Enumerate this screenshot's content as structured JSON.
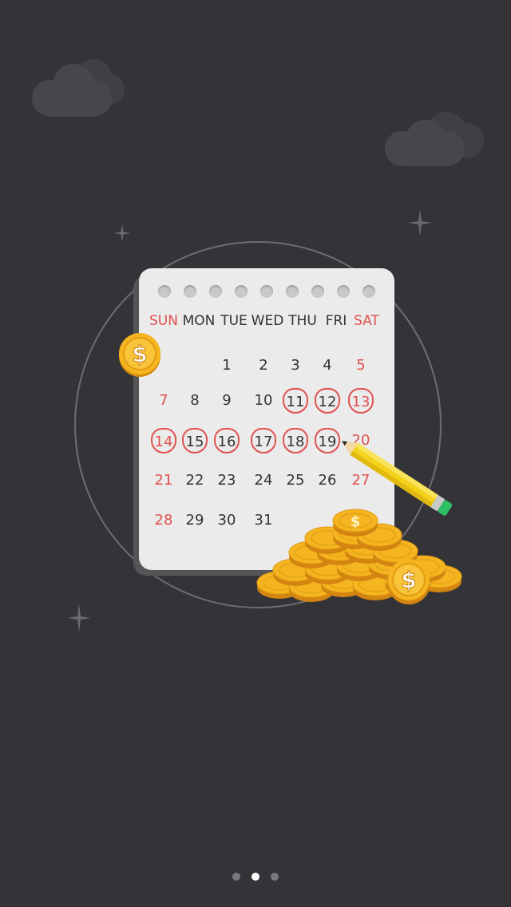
{
  "calendar": {
    "weekdays": [
      "SUN",
      "MON",
      "TUE",
      "WED",
      "THU",
      "FRI",
      "SAT"
    ],
    "weeks": [
      [
        "",
        "",
        "1",
        "2",
        "3",
        "4",
        "5"
      ],
      [
        "7",
        "8",
        "9",
        "10",
        "11",
        "12",
        "13"
      ],
      [
        "14",
        "15",
        "16",
        "17",
        "18",
        "19",
        "20"
      ],
      [
        "21",
        "22",
        "23",
        "24",
        "25",
        "26",
        "27"
      ],
      [
        "28",
        "29",
        "30",
        "31",
        "",
        "",
        ""
      ]
    ],
    "marked_days": [
      "11",
      "12",
      "13",
      "14",
      "15",
      "16",
      "17",
      "18",
      "19"
    ]
  },
  "coin_symbol": "$",
  "pager": {
    "total": 3,
    "active_index": 1
  },
  "colors": {
    "background": "#343338",
    "accent_red": "#e0514f",
    "coin_gold": "#f5b520",
    "pencil_yellow": "#f4d21c",
    "pencil_green": "#2fbf63"
  }
}
